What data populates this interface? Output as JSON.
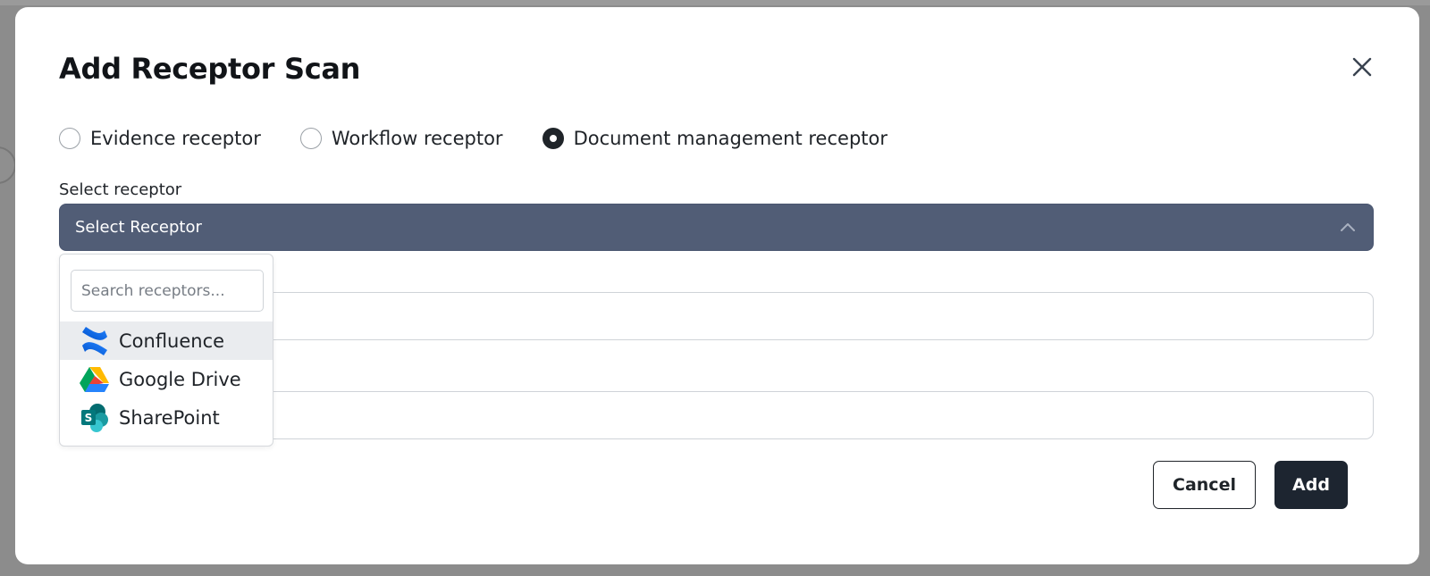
{
  "modal": {
    "title": "Add Receptor Scan",
    "close_icon": "close-icon"
  },
  "receptor_types": [
    {
      "label": "Evidence receptor",
      "selected": false
    },
    {
      "label": "Workflow receptor",
      "selected": false
    },
    {
      "label": "Document management receptor",
      "selected": true
    }
  ],
  "select_receptor": {
    "label": "Select receptor",
    "value": "Select Receptor",
    "chevron_icon": "chevron-up-icon",
    "dropdown": {
      "search_placeholder": "Search receptors...",
      "options": [
        {
          "label": "Confluence",
          "icon": "confluence-icon",
          "highlighted": true
        },
        {
          "label": "Google Drive",
          "icon": "google-drive-icon",
          "highlighted": false
        },
        {
          "label": "SharePoint",
          "icon": "sharepoint-icon",
          "highlighted": false
        }
      ]
    }
  },
  "footer": {
    "cancel_label": "Cancel",
    "add_label": "Add"
  },
  "colors": {
    "select_bg": "#515d76",
    "primary_button": "#1d2530",
    "highlight_row": "#eaecef"
  }
}
